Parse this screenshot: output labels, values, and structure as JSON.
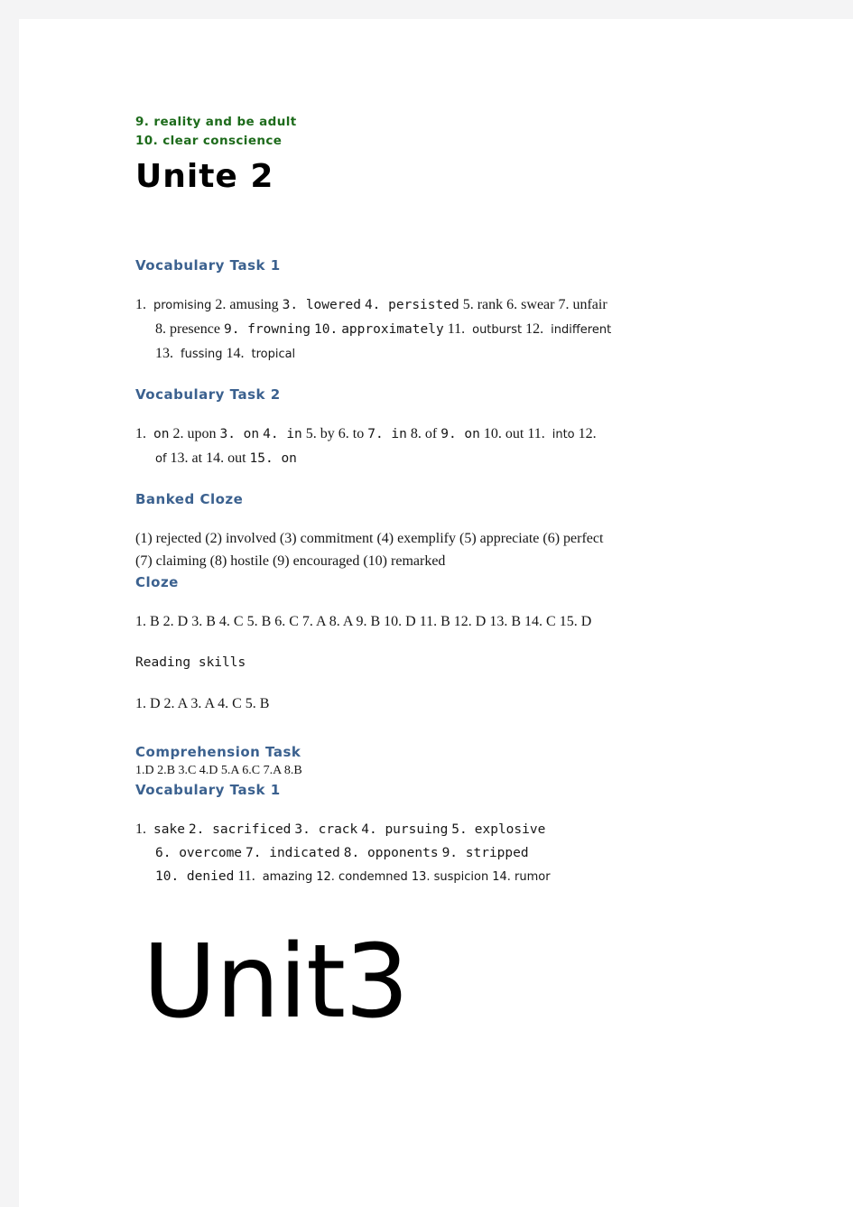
{
  "page": {
    "background_color": "#f4f4f5",
    "sheet_color": "#ffffff",
    "heading_blue": "#3b618f",
    "heading_green": "#1d6b1b",
    "body_color": "#171717"
  },
  "carryover": {
    "item_9": "9. reality and be adult",
    "item_10": "10. clear conscience"
  },
  "unit2": {
    "title": "Unite 2",
    "vocab_task_1": {
      "heading": "Vocabulary Task 1",
      "line_1_a": "1.",
      "line_1_b": "promising",
      "line_1_c": "2. amusing",
      "line_1_d": "3. lowered",
      "line_1_e": "4. persisted",
      "line_1_f": "5. rank",
      "line_1_g": "6. swear",
      "line_1_h": "7. unfair",
      "line_2_a": "8. presence",
      "line_2_b": "9. frowning",
      "line_2_c": "10.",
      "line_2_d": "approximately",
      "line_2_e": "11.",
      "line_2_f": "outburst",
      "line_2_g": "12.",
      "line_2_h": "indifferent",
      "line_3_a": "13.",
      "line_3_b": "fussing",
      "line_3_c": "14.",
      "line_3_d": "tropical"
    },
    "vocab_task_2": {
      "heading": "Vocabulary Task 2",
      "line_1_a": "1.",
      "line_1_b": "on",
      "line_1_c": "2. upon",
      "line_1_d": "3. on",
      "line_1_e": "4. in",
      "line_1_f": "5. by",
      "line_1_g": "6. to",
      "line_1_h": "7. in",
      "line_1_i": "8. of",
      "line_1_j": "9. on",
      "line_1_k": "10. out",
      "line_1_l": "11.",
      "line_1_m": "into",
      "line_1_n": "12.",
      "line_2_a": "of",
      "line_2_b": "13. at",
      "line_2_c": "14. out",
      "line_2_d": "15. on"
    },
    "banked_cloze": {
      "heading": "Banked Cloze",
      "line_1": "(1)  rejected  (2)  involved  (3)  commitment  (4)  exemplify  (5)  appreciate  (6)  perfect",
      "line_2": "(7)  claiming  (8)  hostile  (9)  encouraged  (10)  remarked"
    },
    "cloze": {
      "heading": "Cloze",
      "answers": "1. B  2. D  3. B  4. C  5. B  6. C  7. A  8. A  9. B  10. D  11. B  12. D  13. B  14. C  15. D"
    },
    "reading_skills": {
      "heading": "Reading skills",
      "answers": "1. D  2. A  3. A  4. C  5. B"
    },
    "comprehension_task": {
      "heading": "Comprehension Task",
      "answers": "1.D  2.B  3.C  4.D  5.A  6.C  7.A  8.B"
    },
    "vocab_task_1_second": {
      "heading": "Vocabulary Task 1",
      "line_1_a": "1.",
      "line_1_b": "sake",
      "line_1_c": "2. sacrificed",
      "line_1_d": "3. crack",
      "line_1_e": "4. pursuing",
      "line_1_f": "5.",
      "line_1_g": "explosive",
      "line_2_a": "6. overcome",
      "line_2_b": "7. indicated",
      "line_2_c": "8. opponents",
      "line_2_d": "9. stripped",
      "line_3_a": "10. denied",
      "line_3_b": "11.",
      "line_3_c": "amazing",
      "line_3_d": "12. condemned",
      "line_3_e": "13. suspicion",
      "line_3_f": "14. rumor"
    }
  },
  "unit3": {
    "title": "Unit3"
  }
}
